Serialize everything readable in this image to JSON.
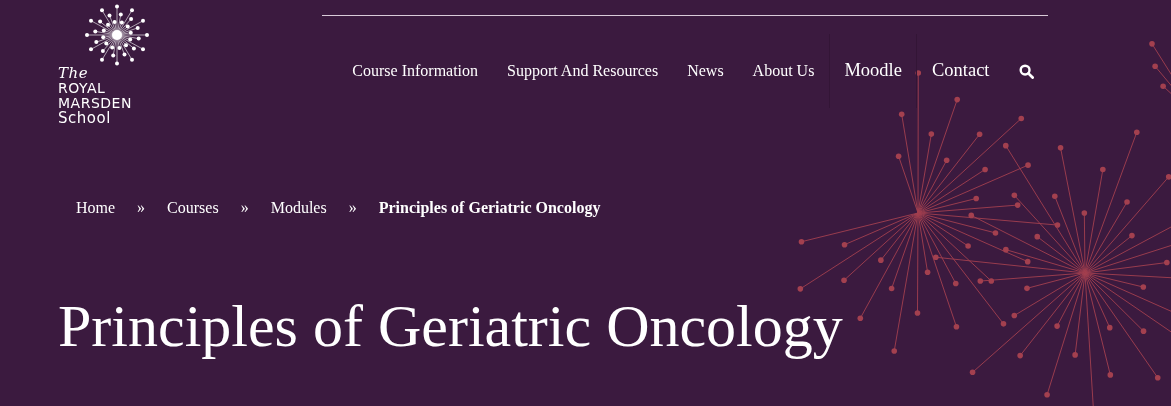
{
  "logo": {
    "lines": [
      "The",
      "ROYAL",
      "MARSDEN",
      "School"
    ]
  },
  "nav": {
    "items": [
      {
        "label": "Course Information",
        "emphasis": false
      },
      {
        "label": "Support And Resources",
        "emphasis": false
      },
      {
        "label": "News",
        "emphasis": false
      },
      {
        "label": "About Us",
        "emphasis": false
      },
      {
        "label": "Moodle",
        "emphasis": true
      },
      {
        "label": "Contact",
        "emphasis": true
      }
    ]
  },
  "breadcrumb": {
    "items": [
      {
        "label": "Home",
        "current": false
      },
      {
        "label": "Courses",
        "current": false
      },
      {
        "label": "Modules",
        "current": false
      },
      {
        "label": "Principles of Geriatric Oncology",
        "current": true
      }
    ],
    "separators": [
      "»",
      "»",
      "»"
    ]
  },
  "page_title": "Principles of Geriatric Oncology"
}
